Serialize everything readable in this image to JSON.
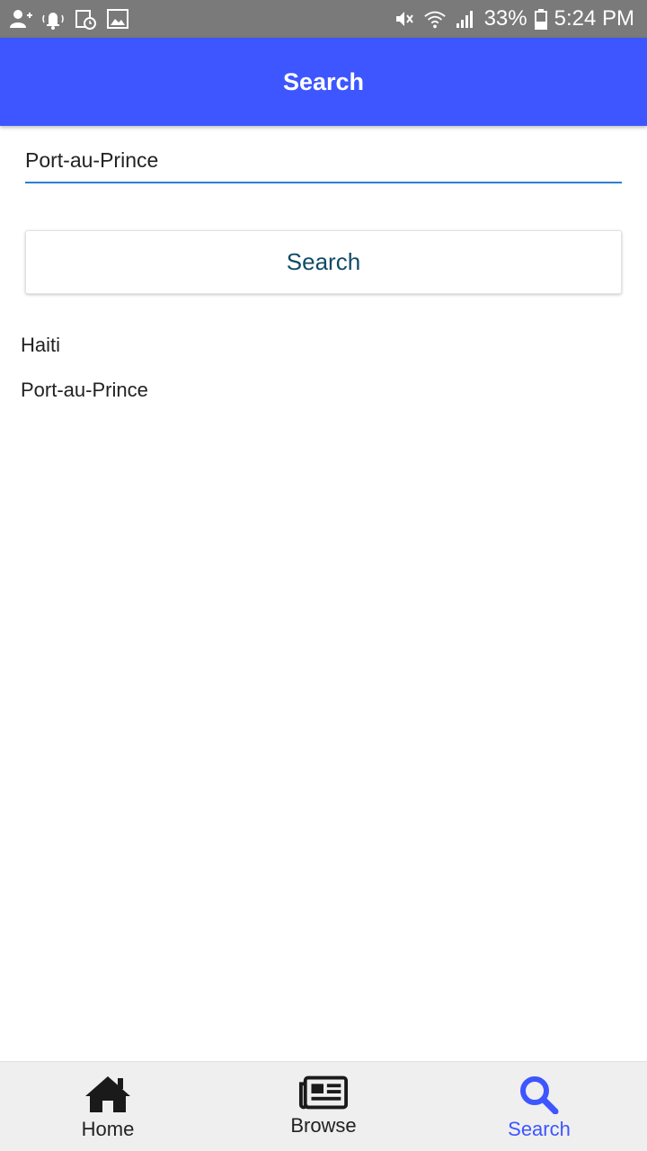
{
  "status_bar": {
    "left_icons": [
      "add-user-icon",
      "notification-bell-icon",
      "calendar-clock-icon",
      "image-icon"
    ],
    "right_icons": [
      "mute-icon",
      "wifi-icon",
      "signal-icon"
    ],
    "battery_percent": "33%",
    "time": "5:24 PM"
  },
  "app_bar": {
    "title": "Search",
    "color": "#3d56ff"
  },
  "search": {
    "value": "Port-au-Prince",
    "button_label": "Search"
  },
  "results": [
    "Haiti",
    "Port-au-Prince"
  ],
  "bottom_nav": {
    "items": [
      {
        "label": "Home",
        "icon": "home-icon"
      },
      {
        "label": "Browse",
        "icon": "newspaper-icon"
      },
      {
        "label": "Search",
        "icon": "search-icon"
      }
    ],
    "active_index": 2,
    "active_color": "#3d56ff"
  }
}
